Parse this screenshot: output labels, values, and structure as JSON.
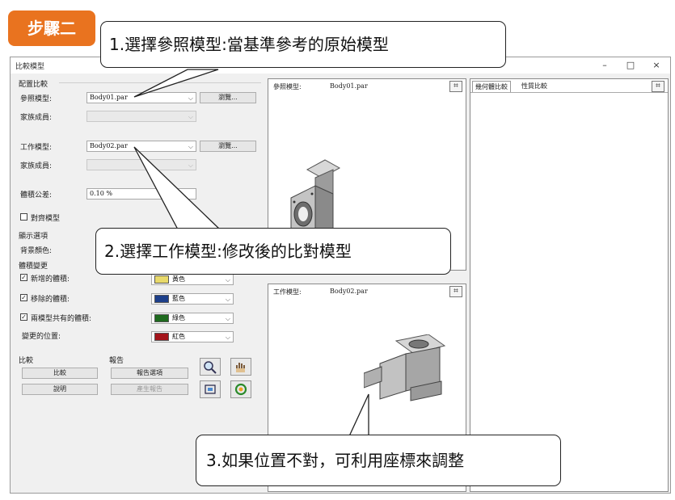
{
  "step_badge": "步驟二",
  "callouts": [
    "1.選擇參照模型:當基準參考的原始模型",
    "2.選擇工作模型:修改後的比對模型",
    "3.如果位置不對，可利用座標來調整"
  ],
  "window": {
    "title": "比較模型",
    "controls": [
      "–",
      "□",
      "×"
    ]
  },
  "config": {
    "group": "配置比較",
    "ref_model_label": "參照模型:",
    "ref_model_value": "Body01.par",
    "browse_label": "瀏覽...",
    "family_label": "家族成員:",
    "work_model_label": "工作模型:",
    "work_model_value": "Body02.par",
    "tolerance_label": "體積公差:",
    "tolerance_value": "0.10 %",
    "align_label": "對齊模型"
  },
  "display": {
    "group": "顯示選項",
    "bg_color_label": "背景顏色:",
    "volume_change_group": "體積變更",
    "added_label": "新增的體積:",
    "added_color_name": "黃色",
    "removed_label": "移除的體積:",
    "removed_color_name": "藍色",
    "common_label": "兩模型共有的體積:",
    "common_color_name": "綠色",
    "changed_pos_label": "變更的位置:",
    "changed_color_name": "紅色",
    "colors": {
      "yellow": "#e8d96a",
      "blue": "#1d3f8a",
      "green": "#1f6b1f",
      "red": "#a3141b"
    }
  },
  "compare": {
    "group": "比較",
    "compare_button": "比較",
    "help_button": "說明"
  },
  "report": {
    "group": "報告",
    "options_button": "報告選項",
    "generate_button": "產生報告"
  },
  "views": {
    "ref_label": "參照模型:",
    "ref_file": "Body01.par",
    "work_label": "工作模型:",
    "work_file": "Body02.par"
  },
  "results": {
    "tabs": [
      "幾何體比較",
      "性質比較"
    ]
  },
  "icons": [
    "zoom-icon",
    "pan-hand-icon",
    "fit-view-icon",
    "rotate-icon",
    "fit-icon"
  ]
}
